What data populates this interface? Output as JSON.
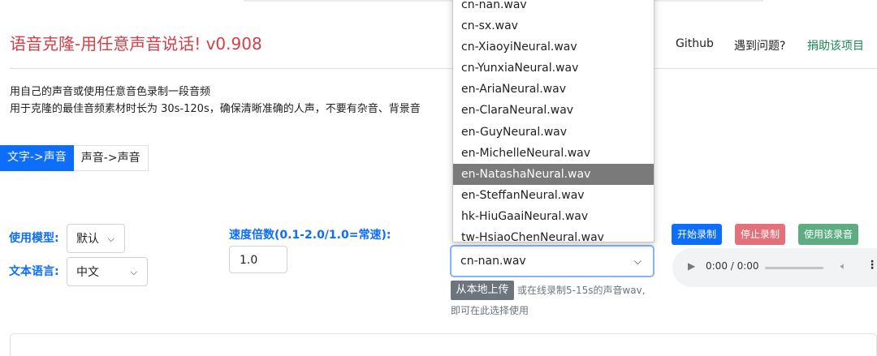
{
  "header": {
    "title": "语音克隆-用任意声音说话! v0.908",
    "nav": [
      "Github",
      "遇到问题?",
      "捐助该项目"
    ]
  },
  "description": {
    "line1": "用自己的声音或使用任意音色录制一段音频",
    "line2": "用于克隆的最佳音频素材时长为 30s-120s，确保清晰准确的人声，不要有杂音、背景音"
  },
  "tabs": [
    {
      "label": "文字->声音",
      "active": true
    },
    {
      "label": "声音->声音",
      "active": false
    }
  ],
  "form": {
    "model_label": "使用模型:",
    "model_value": "默认",
    "language_label": "文本语言:",
    "language_value": "中文",
    "speed_label": "速度倍数(0.1-2.0/1.0=常速):",
    "speed_value": "1.0",
    "voice_value": "cn-nan.wav",
    "voice_options": [
      "cn-nan.wav",
      "cn-sx.wav",
      "cn-XiaoyiNeural.wav",
      "cn-YunxiaNeural.wav",
      "en-AriaNeural.wav",
      "en-ClaraNeural.wav",
      "en-GuyNeural.wav",
      "en-MichelleNeural.wav",
      "en-NatashaNeural.wav",
      "en-SteffanNeural.wav",
      "hk-HiuGaaiNeural.wav",
      "tw-HsiaoChenNeural.wav"
    ],
    "highlighted_option": "en-NatashaNeural.wav",
    "upload_label": "从本地上传",
    "hint_line1": "或在线录制5-15s的声音wav,",
    "hint_line2": "即可在此选择使用"
  },
  "record": {
    "start_label": "开始录制",
    "stop_label": "停止录制",
    "use_label": "使用该录音",
    "time": "0:00 / 0:00"
  },
  "colors": {
    "title": "#d33f49",
    "primary": "#0d6efd",
    "green": "#198754",
    "stop": "#e4717a",
    "use": "#5ead82"
  }
}
